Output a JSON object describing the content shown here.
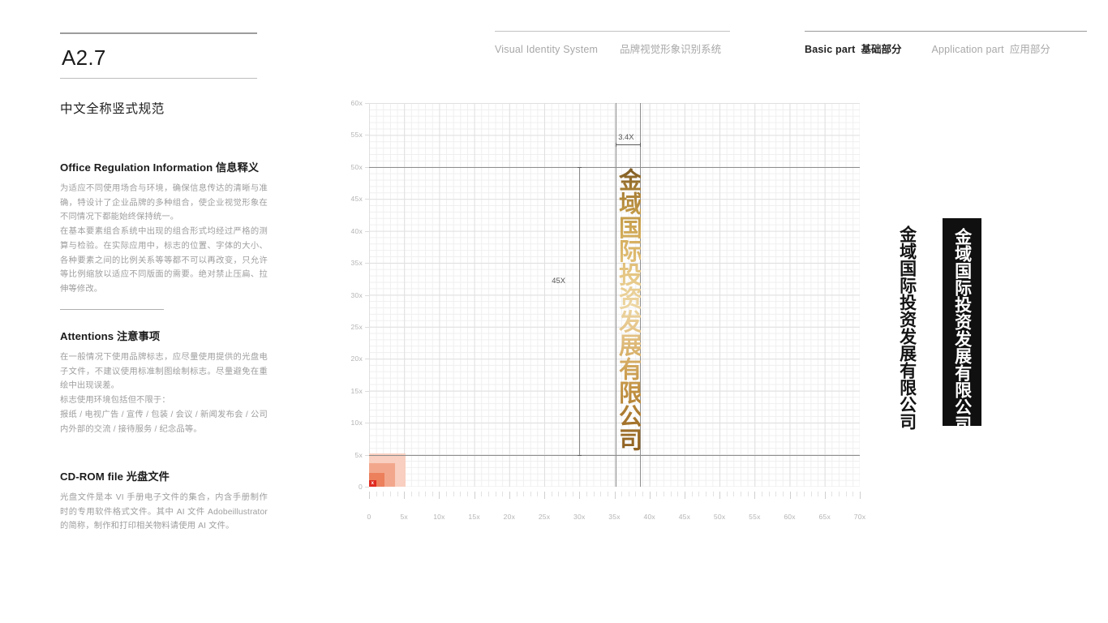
{
  "header": {
    "left_group": {
      "en": "Visual Identity System",
      "cn": "品牌视觉形象识别系统"
    },
    "right_group": {
      "active_en": "Basic part",
      "active_cn": "基础部分",
      "inactive_en": "Application part",
      "inactive_cn": "应用部分"
    }
  },
  "section": {
    "code": "A2.7",
    "subtitle": "中文全称竖式规范"
  },
  "blocks": [
    {
      "heading": "Office Regulation Information 信息释义",
      "paragraphs": [
        "为适应不同使用场合与环境，确保信息传达的清晰与准确，特设计了企业品牌的多种组合，使企业视觉形象在不同情况下都能始终保持统一。",
        "在基本要素组合系统中出现的组合形式均经过严格的测算与检验。在实际应用中，标志的位置、字体的大小、各种要素之间的比例关系等等都不可以再改变，只允许等比例缩放以适应不同版面的需要。绝对禁止压扁、拉伸等修改。"
      ]
    },
    {
      "heading": "Attentions 注意事项",
      "paragraphs": [
        "在一般情况下使用品牌标志，应尽量使用提供的光盘电子文件，不建议使用标准制图绘制标志。尽量避免在重绘中出现误差。",
        "标志使用环境包括但不限于：",
        "报纸 / 电视广告 / 宣传 / 包装 / 会议 / 新闻发布会 / 公司内外部的交流 / 接待服务 / 纪念品等。"
      ]
    },
    {
      "heading": "CD-ROM file 光盘文件",
      "paragraphs": [
        "光盘文件是本 VI 手册电子文件的集合，内含手册制作时的专用软件格式文件。其中 AI 文件 Adobeillustrator 的简称，制作和打印相关物料请使用 AI 文件。"
      ]
    }
  ],
  "logo": {
    "text": "金域国际投资发展有限公司",
    "gold_top_color": "#7d5a23",
    "gold_mid_color": "#edd6a2",
    "gold_bottom_color": "#8a5d20",
    "mono_color": "#141414",
    "knockout_bg": "#101010",
    "knockout_color": "#ffffff"
  },
  "chart_data": {
    "type": "grid-diagram",
    "title": "中文全称竖式规范",
    "xlabel": "",
    "ylabel": "",
    "x_ticks": [
      "0",
      "5x",
      "10x",
      "15x",
      "20x",
      "25x",
      "30x",
      "35x",
      "40x",
      "45x",
      "50x",
      "55x",
      "60x",
      "65x",
      "70x"
    ],
    "y_ticks": [
      "0",
      "5x",
      "10x",
      "15x",
      "20x",
      "25x",
      "30x",
      "35x",
      "40x",
      "45x",
      "50x",
      "55x",
      "60x"
    ],
    "xlim": [
      0,
      70
    ],
    "ylim": [
      0,
      60
    ],
    "grid": true,
    "minor_step": 1,
    "major_step": 5,
    "annotations": [
      {
        "label": "3.4X",
        "kind": "horizontal-dimension",
        "from_x": 35.2,
        "to_x": 38.6,
        "at_y": 53.5
      },
      {
        "label": "45X",
        "kind": "vertical-dimension",
        "at_x": 30,
        "from_y": 5,
        "to_y": 50
      }
    ],
    "guides": [
      {
        "kind": "horizontal",
        "y": 50
      },
      {
        "kind": "horizontal",
        "y": 5
      },
      {
        "kind": "vertical",
        "x": 35.2
      },
      {
        "kind": "vertical",
        "x": 38.6
      }
    ],
    "logo_placement": {
      "x": 35.2,
      "y_top": 50,
      "y_bottom": 5,
      "width_x": 3.4,
      "height_x": 45
    },
    "origin_swatches": [
      {
        "name": "outer",
        "color": "#f8cfc0",
        "x": 0,
        "y": 0,
        "w": 5.2,
        "h": 5.2
      },
      {
        "name": "mid",
        "color": "#f2a78c",
        "x": 0,
        "y": 0,
        "w": 3.7,
        "h": 3.7
      },
      {
        "name": "inner",
        "color": "#ec7f5c",
        "x": 0,
        "y": 0,
        "w": 2.2,
        "h": 2.2
      },
      {
        "name": "core",
        "color": "#e02b20",
        "x": 0,
        "y": 0,
        "w": 1.0,
        "h": 1.0,
        "label": "x"
      }
    ]
  }
}
